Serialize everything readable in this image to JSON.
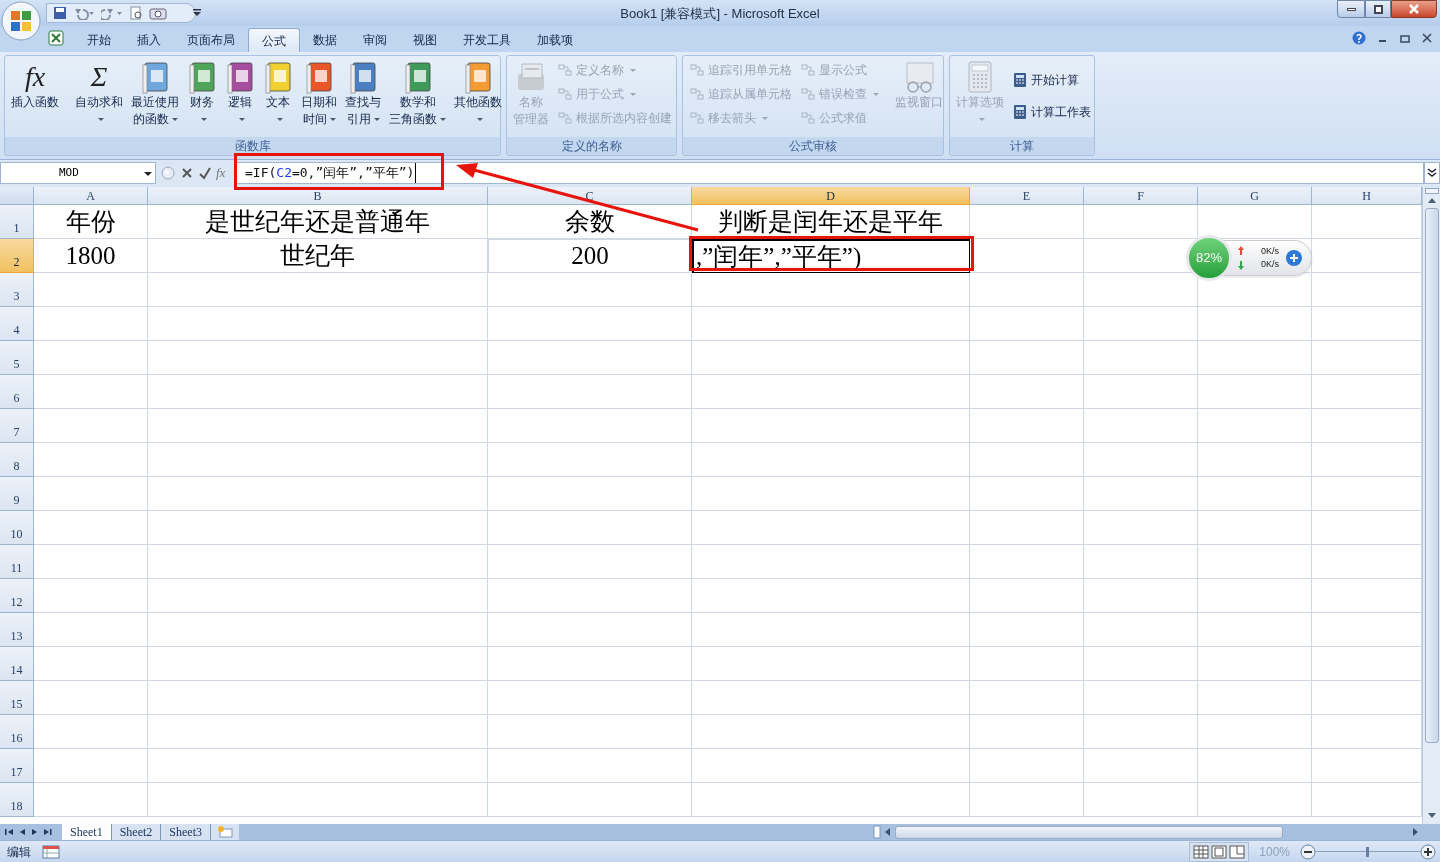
{
  "window": {
    "title": "Book1  [兼容模式]  -  Microsoft Excel"
  },
  "tabs": [
    {
      "label": "开始",
      "selected": false
    },
    {
      "label": "插入",
      "selected": false
    },
    {
      "label": "页面布局",
      "selected": false
    },
    {
      "label": "公式",
      "selected": true
    },
    {
      "label": "数据",
      "selected": false
    },
    {
      "label": "审阅",
      "selected": false
    },
    {
      "label": "视图",
      "selected": false
    },
    {
      "label": "开发工具",
      "selected": false
    },
    {
      "label": "加载项",
      "selected": false
    }
  ],
  "ribbon": {
    "groups": [
      {
        "label": "函数库",
        "items": [
          {
            "kind": "glyph",
            "glyph": "fx",
            "lines": [
              "插入函数"
            ],
            "dropdown": false,
            "disabled": false
          },
          {
            "kind": "separator"
          },
          {
            "kind": "glyph",
            "glyph": "Σ",
            "lines": [
              "自动求和"
            ],
            "dropdown": true,
            "disabled": false
          },
          {
            "kind": "book",
            "color": "#6fa8dc",
            "lines": [
              "最近使用",
              "的函数"
            ],
            "dropdown": true,
            "disabled": false
          },
          {
            "kind": "book",
            "color": "#4fa65a",
            "lines": [
              "财务"
            ],
            "dropdown": true,
            "disabled": false
          },
          {
            "kind": "book",
            "color": "#a64d9e",
            "lines": [
              "逻辑"
            ],
            "dropdown": true,
            "disabled": false
          },
          {
            "kind": "book",
            "color": "#f0d030",
            "lines": [
              "文本"
            ],
            "dropdown": true,
            "disabled": false
          },
          {
            "kind": "book",
            "color": "#e8562a",
            "lines": [
              "日期和",
              "时间"
            ],
            "dropdown": true,
            "disabled": false
          },
          {
            "kind": "book",
            "color": "#4a7fc1",
            "lines": [
              "查找与",
              "引用"
            ],
            "dropdown": true,
            "disabled": false
          },
          {
            "kind": "book",
            "color": "#3e9b5a",
            "lines": [
              "数学和",
              "三角函数"
            ],
            "dropdown": true,
            "disabled": false
          },
          {
            "kind": "book",
            "color": "#f39c34",
            "lines": [
              "其他函数"
            ],
            "dropdown": true,
            "disabled": false
          }
        ]
      },
      {
        "label": "定义的名称",
        "items": [
          {
            "kind": "cards",
            "lines": [
              "名称",
              "管理器"
            ],
            "dropdown": false,
            "disabled": true
          },
          {
            "kind": "small",
            "lines": [
              "定义名称"
            ],
            "dropdown": true,
            "disabled": true
          },
          {
            "kind": "small",
            "lines": [
              "用于公式"
            ],
            "dropdown": true,
            "disabled": true
          },
          {
            "kind": "small",
            "lines": [
              "根据所选内容创建"
            ],
            "dropdown": false,
            "disabled": true
          }
        ]
      },
      {
        "label": "公式审核",
        "items": [
          {
            "kind": "small",
            "lines": [
              "追踪引用单元格"
            ],
            "dropdown": false,
            "disabled": true
          },
          {
            "kind": "small",
            "lines": [
              "追踪从属单元格"
            ],
            "dropdown": false,
            "disabled": true
          },
          {
            "kind": "small",
            "lines": [
              "移去箭头"
            ],
            "dropdown": true,
            "disabled": true
          },
          {
            "kind": "small",
            "lines": [
              "显示公式"
            ],
            "dropdown": false,
            "disabled": true
          },
          {
            "kind": "small",
            "lines": [
              "错误检查"
            ],
            "dropdown": true,
            "disabled": true
          },
          {
            "kind": "small",
            "lines": [
              "公式求值"
            ],
            "dropdown": false,
            "disabled": true
          },
          {
            "kind": "separator"
          },
          {
            "kind": "glasses",
            "lines": [
              "监视窗口"
            ],
            "dropdown": false,
            "disabled": true
          }
        ]
      },
      {
        "label": "计算",
        "items": [
          {
            "kind": "calculator",
            "lines": [
              "计算选项"
            ],
            "dropdown": true,
            "disabled": true
          },
          {
            "kind": "small",
            "lines": [
              "开始计算"
            ],
            "dropdown": false,
            "disabled": false
          },
          {
            "kind": "small",
            "lines": [
              "计算工作表"
            ],
            "dropdown": false,
            "disabled": false
          }
        ]
      }
    ]
  },
  "formula_bar": {
    "name_box": "MOD",
    "fx": "fx",
    "formula": [
      {
        "text": "=IF(",
        "ref": false
      },
      {
        "text": "C2",
        "ref": true
      },
      {
        "text": "=0,”闰年”,”平年”)",
        "ref": false
      }
    ]
  },
  "grid": {
    "columns": [
      {
        "label": "A",
        "selected": false
      },
      {
        "label": "B",
        "selected": false
      },
      {
        "label": "C",
        "selected": false
      },
      {
        "label": "D",
        "selected": true
      },
      {
        "label": "E",
        "selected": false
      },
      {
        "label": "F",
        "selected": false
      },
      {
        "label": "G",
        "selected": false
      },
      {
        "label": "H",
        "selected": false
      }
    ],
    "rows": [
      {
        "label": "1",
        "selected": false,
        "cells": [
          {
            "text": "年份",
            "referenced": false,
            "editing": false
          },
          {
            "text": "是世纪年还是普通年",
            "referenced": false,
            "editing": false
          },
          {
            "text": "余数",
            "referenced": false,
            "editing": false
          },
          {
            "text": "判断是闰年还是平年",
            "referenced": false,
            "editing": false
          }
        ]
      },
      {
        "label": "2",
        "selected": true,
        "cells": [
          {
            "text": "1800",
            "referenced": false,
            "editing": false
          },
          {
            "text": "世纪年",
            "referenced": false,
            "editing": false
          },
          {
            "text": "200",
            "referenced": true,
            "editing": false
          },
          {
            "text": ",”闰年”,”平年”)",
            "referenced": false,
            "editing": true
          }
        ]
      },
      {
        "label": "3",
        "selected": false
      },
      {
        "label": "4",
        "selected": false
      },
      {
        "label": "5",
        "selected": false
      },
      {
        "label": "6",
        "selected": false
      },
      {
        "label": "7",
        "selected": false
      },
      {
        "label": "8",
        "selected": false
      },
      {
        "label": "9",
        "selected": false
      },
      {
        "label": "10",
        "selected": false
      },
      {
        "label": "11",
        "selected": false
      },
      {
        "label": "12",
        "selected": false
      },
      {
        "label": "13",
        "selected": false
      },
      {
        "label": "14",
        "selected": false
      },
      {
        "label": "15",
        "selected": false
      },
      {
        "label": "16",
        "selected": false
      },
      {
        "label": "17",
        "selected": false
      },
      {
        "label": "18",
        "selected": false
      }
    ]
  },
  "speed_widget": {
    "percent": "82%",
    "upload": "0K/s",
    "download": "0K/s"
  },
  "sheet_tabs": [
    {
      "label": "Sheet1",
      "selected": true
    },
    {
      "label": "Sheet2",
      "selected": false
    },
    {
      "label": "Sheet3",
      "selected": false
    }
  ],
  "status_bar": {
    "mode": "编辑",
    "zoom": "100%",
    "zoom_slider": {
      "level": 0.5
    }
  }
}
